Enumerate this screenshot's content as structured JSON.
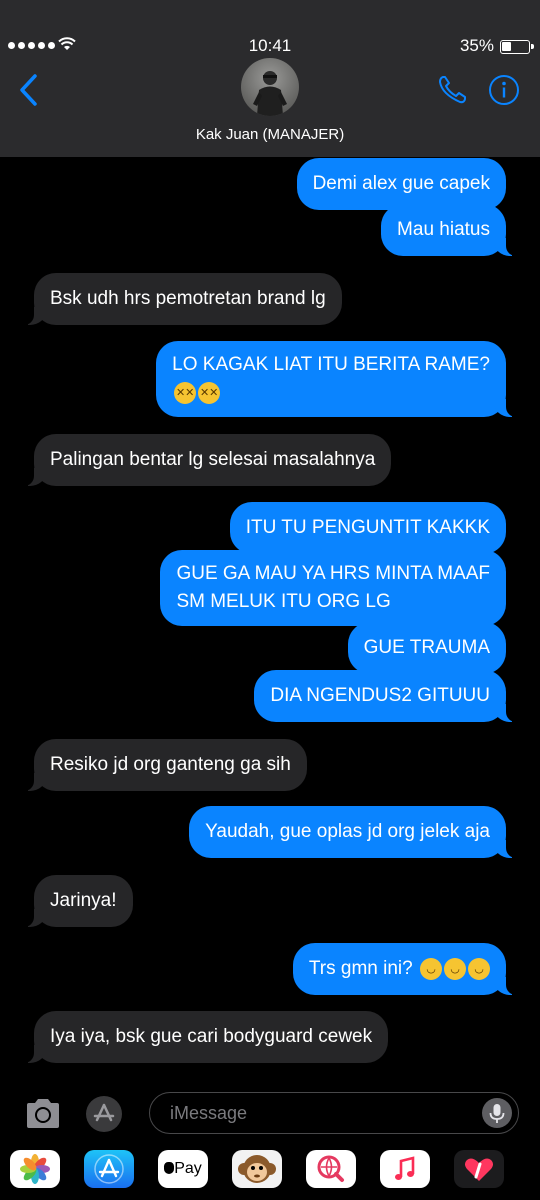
{
  "status": {
    "time": "10:41",
    "battery": "35%"
  },
  "contact": {
    "name": "Kak Juan (MANAJER)"
  },
  "messages": [
    {
      "from": "me",
      "text": "Demi alex gue capek"
    },
    {
      "from": "me",
      "text": "Mau hiatus"
    },
    {
      "from": "them",
      "text": "Bsk udh hrs pemotretan brand lg"
    },
    {
      "from": "me",
      "text": "LO KAGAK LIAT ITU BERITA RAME?"
    },
    {
      "from": "them",
      "text": "Palingan bentar lg selesai masalahnya"
    },
    {
      "from": "me",
      "text": "ITU TU PENGUNTIT KAKKK"
    },
    {
      "from": "me",
      "line1": "GUE GA MAU YA HRS MINTA MAAF",
      "line2": "SM MELUK ITU ORG LG"
    },
    {
      "from": "me",
      "text": "GUE TRAUMA"
    },
    {
      "from": "me",
      "text": "DIA NGENDUS2 GITUUU"
    },
    {
      "from": "them",
      "text": "Resiko jd org ganteng ga sih"
    },
    {
      "from": "me",
      "text": "Yaudah, gue oplas jd org jelek aja"
    },
    {
      "from": "them",
      "text": "Jarinya!"
    },
    {
      "from": "me",
      "text": "Trs gmn ini?"
    },
    {
      "from": "them",
      "text": "Iya iya, bsk gue cari bodyguard cewek"
    }
  ],
  "input": {
    "placeholder": "iMessage"
  },
  "drawer": {
    "applepay_label": "Pay"
  },
  "colors": {
    "outgoing": "#0a84ff",
    "incoming": "#262628",
    "accent": "#0a84ff"
  }
}
